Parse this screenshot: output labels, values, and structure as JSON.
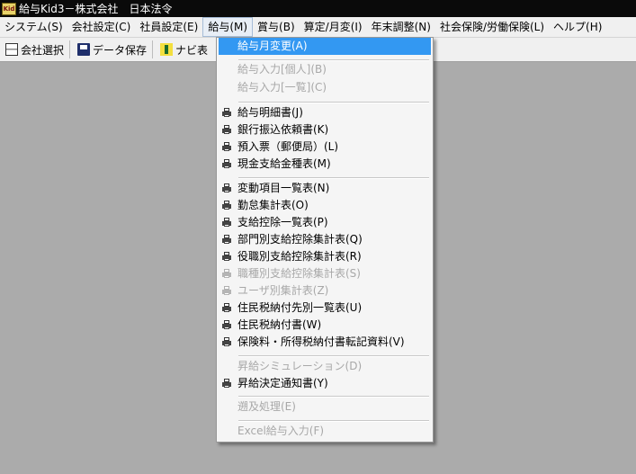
{
  "window": {
    "app_icon_text": "Kid",
    "title": "給与Kid3－株式会社　日本法令"
  },
  "menubar": {
    "items": [
      "システム(S)",
      "会社設定(C)",
      "社員設定(E)",
      "給与(M)",
      "賞与(B)",
      "算定/月変(I)",
      "年末調整(N)",
      "社会保険/労働保険(L)",
      "ヘルプ(H)"
    ]
  },
  "toolbar": {
    "company_select": "会社選択",
    "data_save": "データ保存",
    "navi": "ナビ表"
  },
  "dropdown": {
    "items": [
      {
        "label": "給与月変更(A)",
        "state": "selected",
        "icon": ""
      },
      {
        "label": "給与入力[個人](B)",
        "state": "disabled",
        "icon": ""
      },
      {
        "label": "給与入力[一覧](C)",
        "state": "disabled",
        "icon": ""
      },
      {
        "label": "給与明細書(J)",
        "state": "enabled",
        "icon": "printer-icon"
      },
      {
        "label": "銀行振込依頼書(K)",
        "state": "enabled",
        "icon": "printer-icon"
      },
      {
        "label": "預入票（郵便局）(L)",
        "state": "enabled",
        "icon": "printer-icon"
      },
      {
        "label": "現金支給金種表(M)",
        "state": "enabled",
        "icon": "printer-icon"
      },
      {
        "label": "変動項目一覧表(N)",
        "state": "enabled",
        "icon": "printer-icon"
      },
      {
        "label": "勤怠集計表(O)",
        "state": "enabled",
        "icon": "printer-icon"
      },
      {
        "label": "支給控除一覧表(P)",
        "state": "enabled",
        "icon": "printer-icon"
      },
      {
        "label": "部門別支給控除集計表(Q)",
        "state": "enabled",
        "icon": "printer-icon"
      },
      {
        "label": "役職別支給控除集計表(R)",
        "state": "enabled",
        "icon": "printer-icon"
      },
      {
        "label": "職種別支給控除集計表(S)",
        "state": "disabled",
        "icon": "printer-icon"
      },
      {
        "label": "ユーザ別集計表(Z)",
        "state": "disabled",
        "icon": "printer-icon"
      },
      {
        "label": "住民税納付先別一覧表(U)",
        "state": "enabled",
        "icon": "printer-icon"
      },
      {
        "label": "住民税納付書(W)",
        "state": "enabled",
        "icon": "printer-icon"
      },
      {
        "label": "保険料・所得税納付書転記資料(V)",
        "state": "enabled",
        "icon": "printer-icon"
      },
      {
        "label": "昇給シミュレーション(D)",
        "state": "disabled",
        "icon": ""
      },
      {
        "label": "昇給決定通知書(Y)",
        "state": "enabled",
        "icon": "printer-icon"
      },
      {
        "label": "遡及処理(E)",
        "state": "disabled",
        "icon": ""
      },
      {
        "label": "Excel給与入力(F)",
        "state": "disabled",
        "icon": ""
      }
    ]
  }
}
